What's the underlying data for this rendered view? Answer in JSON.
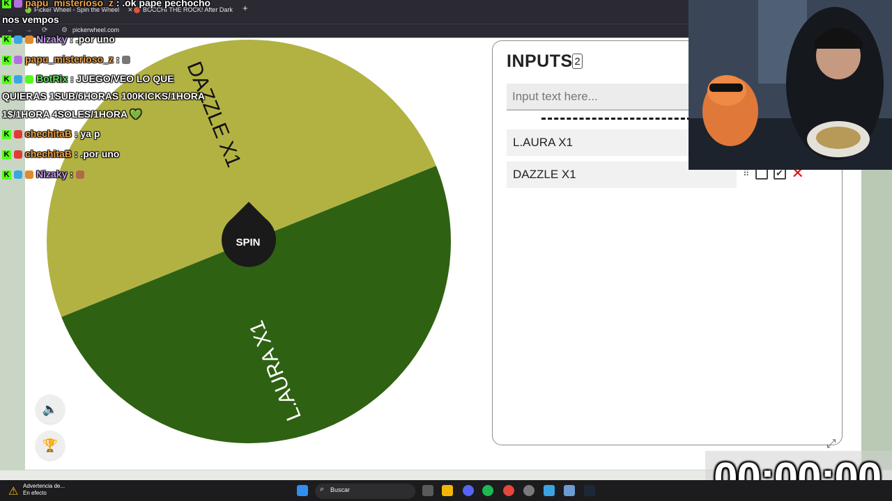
{
  "browser": {
    "tabs": [
      {
        "title": "Picker Wheel - Spin the Wheel"
      },
      {
        "title": "BOCCHI THE ROCK! After Dark"
      }
    ],
    "new_tab_label": "+",
    "url": "pickerwheel.com"
  },
  "wheel": {
    "spin_label": "SPIN",
    "segments": [
      {
        "label": "DAZZLE X1",
        "color": "#b2b243"
      },
      {
        "label": "L.AURA X1",
        "color": "#2f6113"
      }
    ],
    "center_color": "#1a1a1a"
  },
  "inputs_panel": {
    "title": "INPUTS",
    "count": "2",
    "placeholder": "Input text here...",
    "entries": [
      {
        "label": "L.AURA X1"
      },
      {
        "label": "DAZZLE X1"
      }
    ],
    "remove_color": "#dd1111"
  },
  "chat": {
    "messages": [
      {
        "user": "papu_misterioso_z",
        "text": ": .ok pape pechocho"
      },
      {
        "user": "",
        "text": "nos vempos"
      },
      {
        "user": "Nizaky",
        "text": ": .por uno"
      },
      {
        "user": "papu_misterioso_z",
        "text": ":"
      },
      {
        "user": "BotRix",
        "text": ": JUEGO/VEO LO QUE"
      },
      {
        "user": "",
        "text": "QUIERAS 1SUB/6HORAS 100KICKS/1HORA"
      },
      {
        "user": "",
        "text": "1$/1HORA 4SOLES/1HORA 💚"
      },
      {
        "user": "chechitaB",
        "text": ": ya p"
      },
      {
        "user": "chechitaB",
        "text": ": .por uno"
      },
      {
        "user": "Nizaky",
        "text": ":"
      }
    ]
  },
  "timer": {
    "value": "00:00:00"
  },
  "taskbar": {
    "warning_title": "Advertencia de...",
    "warning_subtitle": "En efecto",
    "search_label": "Buscar"
  }
}
